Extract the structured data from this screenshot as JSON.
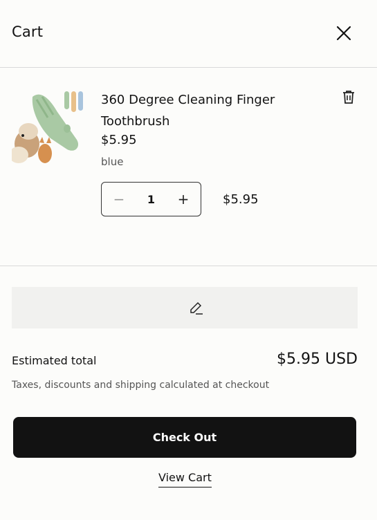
{
  "header": {
    "title": "Cart",
    "close_icon": "close-icon"
  },
  "item": {
    "name": "360 Degree Cleaning Finger Toothbrush",
    "price": "$5.95",
    "variant": "blue",
    "quantity": "1",
    "line_total": "$5.95",
    "minus_glyph": "−",
    "plus_glyph": "+",
    "delete_icon": "trash-icon"
  },
  "note": {
    "icon": "pencil-icon"
  },
  "summary": {
    "estimated_label": "Estimated total",
    "estimated_value": "$5.95 USD",
    "tax_note": "Taxes, discounts and shipping calculated at checkout"
  },
  "actions": {
    "checkout_label": "Check Out",
    "view_cart_label": "View Cart"
  },
  "colors": {
    "background": "#fcfcfa",
    "primary_button": "#121212",
    "note_background": "#f1f1ef",
    "divider": "#d9d9d9"
  }
}
